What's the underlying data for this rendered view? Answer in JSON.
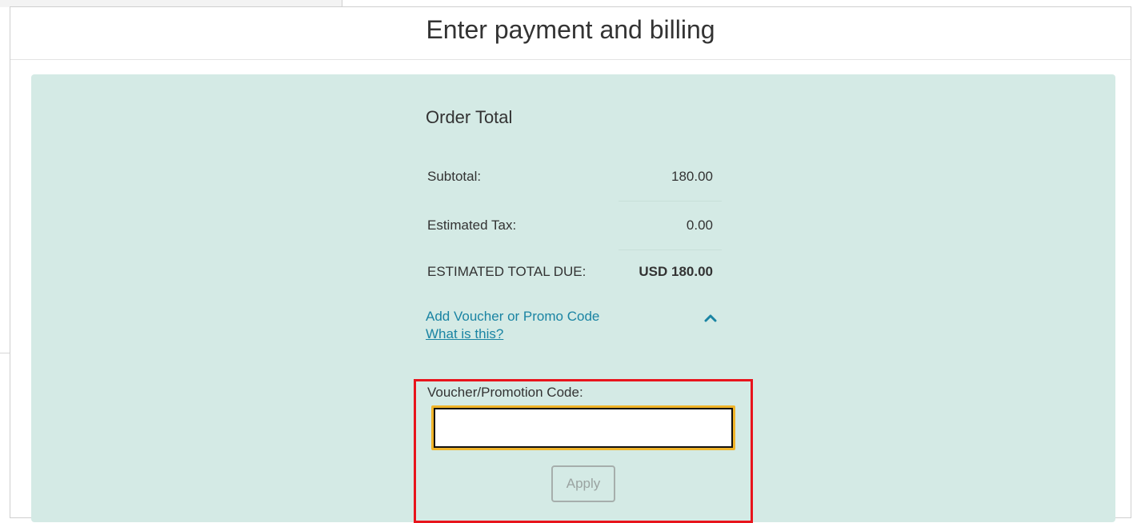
{
  "dialog": {
    "title": "Enter payment and billing"
  },
  "order_summary": {
    "title": "Order Total",
    "rows": [
      {
        "label": "Subtotal:",
        "value": "180.00"
      },
      {
        "label": "Estimated Tax:",
        "value": "0.00"
      },
      {
        "label": "ESTIMATED TOTAL DUE:",
        "value": "USD 180.00"
      }
    ]
  },
  "voucher": {
    "toggle_label": "Add Voucher or Promo Code",
    "help_link": "What is this?",
    "toggle_icon": "chevron-up-icon",
    "field_label": "Voucher/Promotion Code:",
    "field_value": "",
    "apply_label": "Apply"
  },
  "colors": {
    "panel_background": "#d4eae5",
    "link": "#1a84a3",
    "focus_ring": "#f0b429",
    "highlight_border": "#e8141c"
  }
}
